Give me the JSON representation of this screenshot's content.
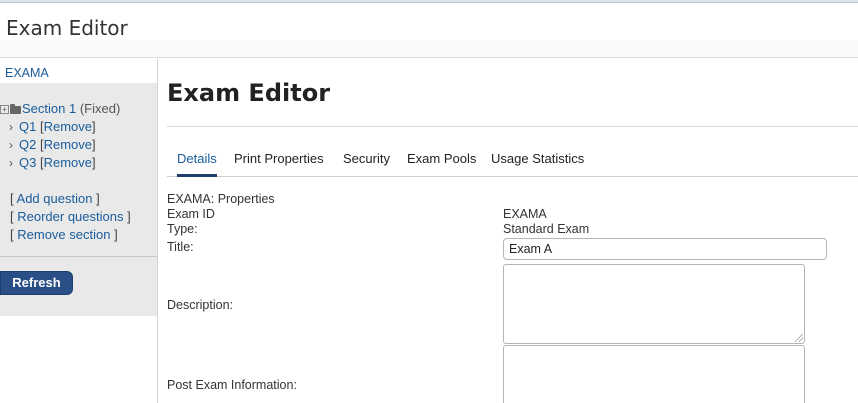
{
  "window": {
    "title": "Exam Editor"
  },
  "sidebar": {
    "exam_code": "EXAMA",
    "section": {
      "name": "Section 1",
      "suffix": "(Fixed)"
    },
    "questions": [
      {
        "label": "Q1",
        "remove": "Remove"
      },
      {
        "label": "Q2",
        "remove": "Remove"
      },
      {
        "label": "Q3",
        "remove": "Remove"
      }
    ],
    "actions": {
      "add_question": "Add question",
      "reorder_questions": "Reorder questions",
      "remove_section": "Remove section"
    },
    "bracket_open": "[",
    "bracket_close": "]",
    "refresh_label": "Refresh"
  },
  "main": {
    "title": "Exam Editor",
    "tabs": [
      "Details",
      "Print Properties",
      "Security",
      "Exam Pools",
      "Usage Statistics"
    ],
    "active_tab": "Details",
    "properties_heading": "EXAMA: Properties",
    "fields": {
      "exam_id_label": "Exam ID",
      "exam_id_value": "EXAMA",
      "type_label": "Type:",
      "type_value": "Standard Exam",
      "title_label": "Title:",
      "title_value": "Exam A",
      "description_label": "Description:",
      "post_exam_label": "Post Exam Information:"
    }
  }
}
